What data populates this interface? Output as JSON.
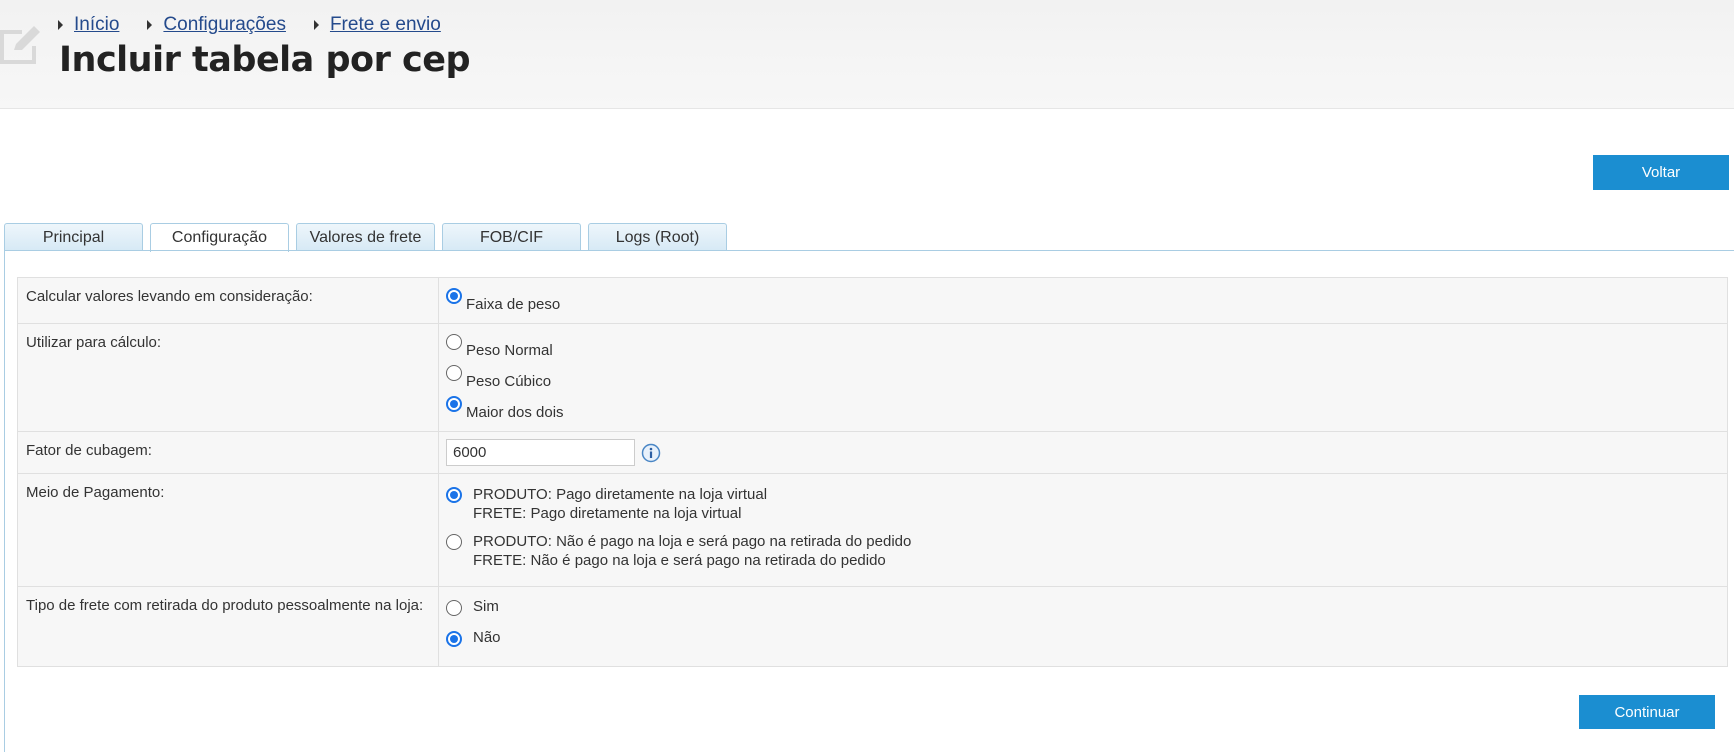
{
  "breadcrumb": [
    "Início",
    "Configurações",
    "Frete e envio"
  ],
  "page_title": "Incluir tabela por cep",
  "buttons": {
    "back": "Voltar",
    "continue": "Continuar"
  },
  "tabs": [
    "Principal",
    "Configuração",
    "Valores de frete",
    "FOB/CIF",
    "Logs (Root)"
  ],
  "active_tab": "Configuração",
  "form": {
    "calc_values": {
      "label": "Calcular valores levando em consideração:",
      "options": [
        "Faixa de peso"
      ],
      "selected": "Faixa de peso"
    },
    "use_for_calc": {
      "label": "Utilizar para cálculo:",
      "options": [
        "Peso Normal",
        "Peso Cúbico",
        "Maior dos dois"
      ],
      "selected": "Maior dos dois"
    },
    "cubage_factor": {
      "label": "Fator de cubagem:",
      "value": "6000",
      "info_icon": "info-icon"
    },
    "payment": {
      "label": "Meio de Pagamento:",
      "options": [
        {
          "line1": "PRODUTO: Pago diretamente na loja virtual",
          "line2": "FRETE: Pago diretamente na loja virtual"
        },
        {
          "line1": "PRODUTO: Não é pago na loja e será pago na retirada do pedido",
          "line2": "FRETE: Não é pago na loja e será pago na retirada do pedido"
        }
      ],
      "selected_index": 0
    },
    "pickup": {
      "label": "Tipo de frete com retirada do produto pessoalmente na loja:",
      "options": [
        "Sim",
        "Não"
      ],
      "selected": "Não"
    }
  },
  "colors": {
    "accent": "#1b8ed1",
    "link": "#244a8c",
    "tab_border": "#a9cde3",
    "radio_checked": "#1a73e8"
  }
}
